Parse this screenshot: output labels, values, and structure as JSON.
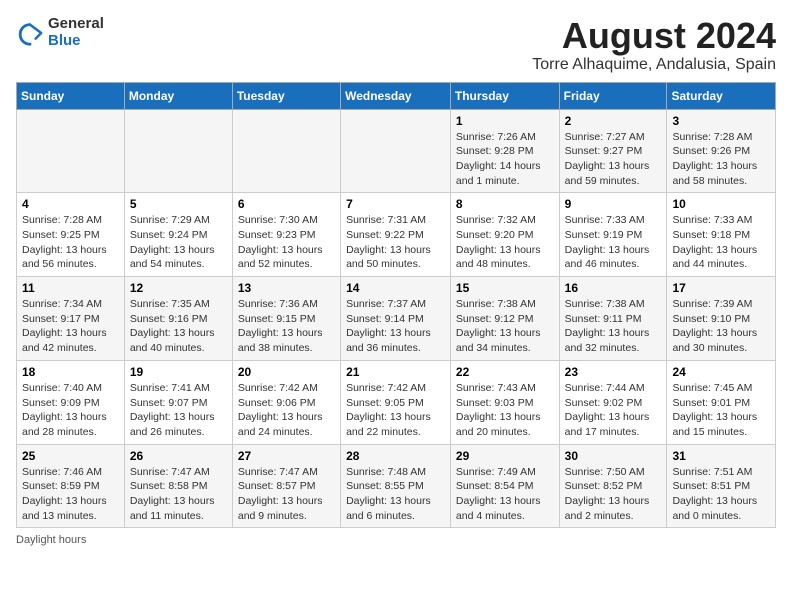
{
  "header": {
    "title": "August 2024",
    "subtitle": "Torre Alhaquime, Andalusia, Spain",
    "logo_general": "General",
    "logo_blue": "Blue"
  },
  "columns": [
    "Sunday",
    "Monday",
    "Tuesday",
    "Wednesday",
    "Thursday",
    "Friday",
    "Saturday"
  ],
  "weeks": [
    [
      {
        "day": "",
        "info": ""
      },
      {
        "day": "",
        "info": ""
      },
      {
        "day": "",
        "info": ""
      },
      {
        "day": "",
        "info": ""
      },
      {
        "day": "1",
        "info": "Sunrise: 7:26 AM\nSunset: 9:28 PM\nDaylight: 14 hours and 1 minute."
      },
      {
        "day": "2",
        "info": "Sunrise: 7:27 AM\nSunset: 9:27 PM\nDaylight: 13 hours and 59 minutes."
      },
      {
        "day": "3",
        "info": "Sunrise: 7:28 AM\nSunset: 9:26 PM\nDaylight: 13 hours and 58 minutes."
      }
    ],
    [
      {
        "day": "4",
        "info": "Sunrise: 7:28 AM\nSunset: 9:25 PM\nDaylight: 13 hours and 56 minutes."
      },
      {
        "day": "5",
        "info": "Sunrise: 7:29 AM\nSunset: 9:24 PM\nDaylight: 13 hours and 54 minutes."
      },
      {
        "day": "6",
        "info": "Sunrise: 7:30 AM\nSunset: 9:23 PM\nDaylight: 13 hours and 52 minutes."
      },
      {
        "day": "7",
        "info": "Sunrise: 7:31 AM\nSunset: 9:22 PM\nDaylight: 13 hours and 50 minutes."
      },
      {
        "day": "8",
        "info": "Sunrise: 7:32 AM\nSunset: 9:20 PM\nDaylight: 13 hours and 48 minutes."
      },
      {
        "day": "9",
        "info": "Sunrise: 7:33 AM\nSunset: 9:19 PM\nDaylight: 13 hours and 46 minutes."
      },
      {
        "day": "10",
        "info": "Sunrise: 7:33 AM\nSunset: 9:18 PM\nDaylight: 13 hours and 44 minutes."
      }
    ],
    [
      {
        "day": "11",
        "info": "Sunrise: 7:34 AM\nSunset: 9:17 PM\nDaylight: 13 hours and 42 minutes."
      },
      {
        "day": "12",
        "info": "Sunrise: 7:35 AM\nSunset: 9:16 PM\nDaylight: 13 hours and 40 minutes."
      },
      {
        "day": "13",
        "info": "Sunrise: 7:36 AM\nSunset: 9:15 PM\nDaylight: 13 hours and 38 minutes."
      },
      {
        "day": "14",
        "info": "Sunrise: 7:37 AM\nSunset: 9:14 PM\nDaylight: 13 hours and 36 minutes."
      },
      {
        "day": "15",
        "info": "Sunrise: 7:38 AM\nSunset: 9:12 PM\nDaylight: 13 hours and 34 minutes."
      },
      {
        "day": "16",
        "info": "Sunrise: 7:38 AM\nSunset: 9:11 PM\nDaylight: 13 hours and 32 minutes."
      },
      {
        "day": "17",
        "info": "Sunrise: 7:39 AM\nSunset: 9:10 PM\nDaylight: 13 hours and 30 minutes."
      }
    ],
    [
      {
        "day": "18",
        "info": "Sunrise: 7:40 AM\nSunset: 9:09 PM\nDaylight: 13 hours and 28 minutes."
      },
      {
        "day": "19",
        "info": "Sunrise: 7:41 AM\nSunset: 9:07 PM\nDaylight: 13 hours and 26 minutes."
      },
      {
        "day": "20",
        "info": "Sunrise: 7:42 AM\nSunset: 9:06 PM\nDaylight: 13 hours and 24 minutes."
      },
      {
        "day": "21",
        "info": "Sunrise: 7:42 AM\nSunset: 9:05 PM\nDaylight: 13 hours and 22 minutes."
      },
      {
        "day": "22",
        "info": "Sunrise: 7:43 AM\nSunset: 9:03 PM\nDaylight: 13 hours and 20 minutes."
      },
      {
        "day": "23",
        "info": "Sunrise: 7:44 AM\nSunset: 9:02 PM\nDaylight: 13 hours and 17 minutes."
      },
      {
        "day": "24",
        "info": "Sunrise: 7:45 AM\nSunset: 9:01 PM\nDaylight: 13 hours and 15 minutes."
      }
    ],
    [
      {
        "day": "25",
        "info": "Sunrise: 7:46 AM\nSunset: 8:59 PM\nDaylight: 13 hours and 13 minutes."
      },
      {
        "day": "26",
        "info": "Sunrise: 7:47 AM\nSunset: 8:58 PM\nDaylight: 13 hours and 11 minutes."
      },
      {
        "day": "27",
        "info": "Sunrise: 7:47 AM\nSunset: 8:57 PM\nDaylight: 13 hours and 9 minutes."
      },
      {
        "day": "28",
        "info": "Sunrise: 7:48 AM\nSunset: 8:55 PM\nDaylight: 13 hours and 6 minutes."
      },
      {
        "day": "29",
        "info": "Sunrise: 7:49 AM\nSunset: 8:54 PM\nDaylight: 13 hours and 4 minutes."
      },
      {
        "day": "30",
        "info": "Sunrise: 7:50 AM\nSunset: 8:52 PM\nDaylight: 13 hours and 2 minutes."
      },
      {
        "day": "31",
        "info": "Sunrise: 7:51 AM\nSunset: 8:51 PM\nDaylight: 13 hours and 0 minutes."
      }
    ]
  ],
  "footer": {
    "note": "Daylight hours"
  }
}
